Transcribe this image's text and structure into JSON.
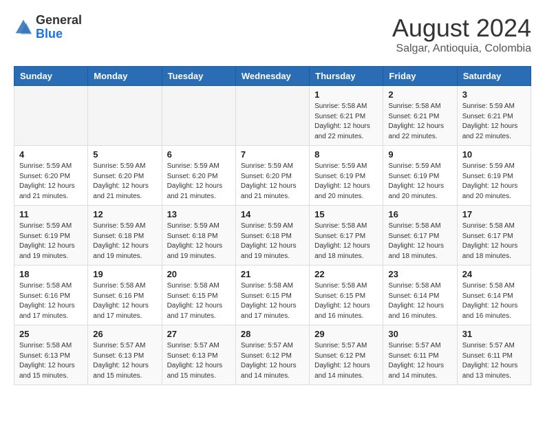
{
  "header": {
    "logo_line1": "General",
    "logo_line2": "Blue",
    "month_year": "August 2024",
    "location": "Salgar, Antioquia, Colombia"
  },
  "weekdays": [
    "Sunday",
    "Monday",
    "Tuesday",
    "Wednesday",
    "Thursday",
    "Friday",
    "Saturday"
  ],
  "weeks": [
    [
      {
        "day": "",
        "content": ""
      },
      {
        "day": "",
        "content": ""
      },
      {
        "day": "",
        "content": ""
      },
      {
        "day": "",
        "content": ""
      },
      {
        "day": "1",
        "content": "Sunrise: 5:58 AM\nSunset: 6:21 PM\nDaylight: 12 hours\nand 22 minutes."
      },
      {
        "day": "2",
        "content": "Sunrise: 5:58 AM\nSunset: 6:21 PM\nDaylight: 12 hours\nand 22 minutes."
      },
      {
        "day": "3",
        "content": "Sunrise: 5:59 AM\nSunset: 6:21 PM\nDaylight: 12 hours\nand 22 minutes."
      }
    ],
    [
      {
        "day": "4",
        "content": "Sunrise: 5:59 AM\nSunset: 6:20 PM\nDaylight: 12 hours\nand 21 minutes."
      },
      {
        "day": "5",
        "content": "Sunrise: 5:59 AM\nSunset: 6:20 PM\nDaylight: 12 hours\nand 21 minutes."
      },
      {
        "day": "6",
        "content": "Sunrise: 5:59 AM\nSunset: 6:20 PM\nDaylight: 12 hours\nand 21 minutes."
      },
      {
        "day": "7",
        "content": "Sunrise: 5:59 AM\nSunset: 6:20 PM\nDaylight: 12 hours\nand 21 minutes."
      },
      {
        "day": "8",
        "content": "Sunrise: 5:59 AM\nSunset: 6:19 PM\nDaylight: 12 hours\nand 20 minutes."
      },
      {
        "day": "9",
        "content": "Sunrise: 5:59 AM\nSunset: 6:19 PM\nDaylight: 12 hours\nand 20 minutes."
      },
      {
        "day": "10",
        "content": "Sunrise: 5:59 AM\nSunset: 6:19 PM\nDaylight: 12 hours\nand 20 minutes."
      }
    ],
    [
      {
        "day": "11",
        "content": "Sunrise: 5:59 AM\nSunset: 6:19 PM\nDaylight: 12 hours\nand 19 minutes."
      },
      {
        "day": "12",
        "content": "Sunrise: 5:59 AM\nSunset: 6:18 PM\nDaylight: 12 hours\nand 19 minutes."
      },
      {
        "day": "13",
        "content": "Sunrise: 5:59 AM\nSunset: 6:18 PM\nDaylight: 12 hours\nand 19 minutes."
      },
      {
        "day": "14",
        "content": "Sunrise: 5:59 AM\nSunset: 6:18 PM\nDaylight: 12 hours\nand 19 minutes."
      },
      {
        "day": "15",
        "content": "Sunrise: 5:58 AM\nSunset: 6:17 PM\nDaylight: 12 hours\nand 18 minutes."
      },
      {
        "day": "16",
        "content": "Sunrise: 5:58 AM\nSunset: 6:17 PM\nDaylight: 12 hours\nand 18 minutes."
      },
      {
        "day": "17",
        "content": "Sunrise: 5:58 AM\nSunset: 6:17 PM\nDaylight: 12 hours\nand 18 minutes."
      }
    ],
    [
      {
        "day": "18",
        "content": "Sunrise: 5:58 AM\nSunset: 6:16 PM\nDaylight: 12 hours\nand 17 minutes."
      },
      {
        "day": "19",
        "content": "Sunrise: 5:58 AM\nSunset: 6:16 PM\nDaylight: 12 hours\nand 17 minutes."
      },
      {
        "day": "20",
        "content": "Sunrise: 5:58 AM\nSunset: 6:15 PM\nDaylight: 12 hours\nand 17 minutes."
      },
      {
        "day": "21",
        "content": "Sunrise: 5:58 AM\nSunset: 6:15 PM\nDaylight: 12 hours\nand 17 minutes."
      },
      {
        "day": "22",
        "content": "Sunrise: 5:58 AM\nSunset: 6:15 PM\nDaylight: 12 hours\nand 16 minutes."
      },
      {
        "day": "23",
        "content": "Sunrise: 5:58 AM\nSunset: 6:14 PM\nDaylight: 12 hours\nand 16 minutes."
      },
      {
        "day": "24",
        "content": "Sunrise: 5:58 AM\nSunset: 6:14 PM\nDaylight: 12 hours\nand 16 minutes."
      }
    ],
    [
      {
        "day": "25",
        "content": "Sunrise: 5:58 AM\nSunset: 6:13 PM\nDaylight: 12 hours\nand 15 minutes."
      },
      {
        "day": "26",
        "content": "Sunrise: 5:57 AM\nSunset: 6:13 PM\nDaylight: 12 hours\nand 15 minutes."
      },
      {
        "day": "27",
        "content": "Sunrise: 5:57 AM\nSunset: 6:13 PM\nDaylight: 12 hours\nand 15 minutes."
      },
      {
        "day": "28",
        "content": "Sunrise: 5:57 AM\nSunset: 6:12 PM\nDaylight: 12 hours\nand 14 minutes."
      },
      {
        "day": "29",
        "content": "Sunrise: 5:57 AM\nSunset: 6:12 PM\nDaylight: 12 hours\nand 14 minutes."
      },
      {
        "day": "30",
        "content": "Sunrise: 5:57 AM\nSunset: 6:11 PM\nDaylight: 12 hours\nand 14 minutes."
      },
      {
        "day": "31",
        "content": "Sunrise: 5:57 AM\nSunset: 6:11 PM\nDaylight: 12 hours\nand 13 minutes."
      }
    ]
  ]
}
